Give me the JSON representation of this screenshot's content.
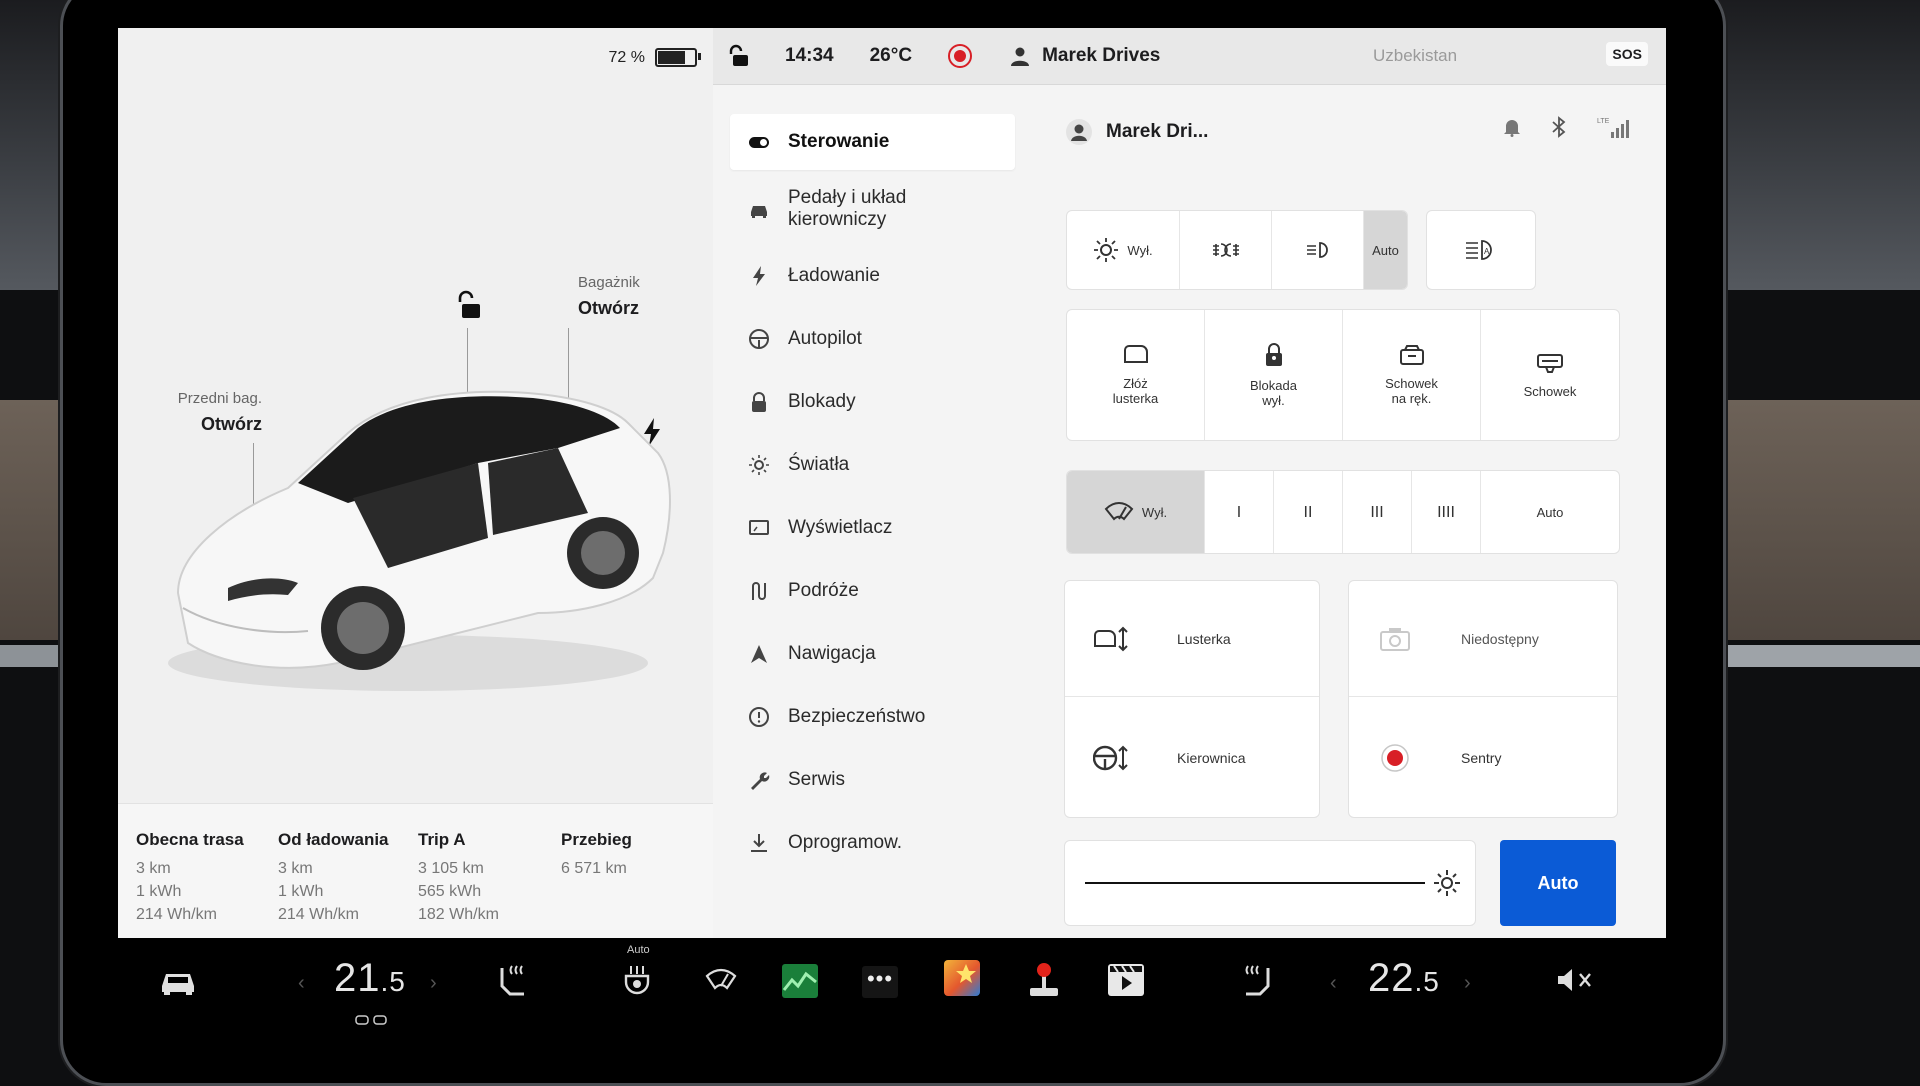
{
  "status": {
    "battery_percent": "72 %",
    "battery_level": 0.72,
    "time": "14:34",
    "temperature": "26°C",
    "user": "Marek Drives",
    "location": "Uzbekistan",
    "sos": "SOS"
  },
  "car": {
    "frunk_label": "Przedni bag.",
    "frunk_action": "Otwórz",
    "trunk_label": "Bagażnik",
    "trunk_action": "Otwórz"
  },
  "trips": [
    {
      "title": "Obecna trasa",
      "distance": "3 km",
      "energy": "1 kWh",
      "efficiency": "214 Wh/km"
    },
    {
      "title": "Od ładowania",
      "distance": "3 km",
      "energy": "1 kWh",
      "efficiency": "214 Wh/km"
    },
    {
      "title": "Trip A",
      "distance": "3 105 km",
      "energy": "565 kWh",
      "efficiency": "182 Wh/km"
    },
    {
      "title": "Przebieg",
      "distance": "6 571 km"
    }
  ],
  "menu": [
    {
      "label": "Sterowanie",
      "icon": "toggle-icon"
    },
    {
      "label": "Pedały i układ kierowniczy",
      "icon": "car-icon"
    },
    {
      "label": "Ładowanie",
      "icon": "bolt-icon"
    },
    {
      "label": "Autopilot",
      "icon": "steering-wheel-icon"
    },
    {
      "label": "Blokady",
      "icon": "lock-icon"
    },
    {
      "label": "Światła",
      "icon": "sun-icon"
    },
    {
      "label": "Wyświetlacz",
      "icon": "display-icon"
    },
    {
      "label": "Podróże",
      "icon": "route-icon"
    },
    {
      "label": "Nawigacja",
      "icon": "navigation-arrow-icon"
    },
    {
      "label": "Bezpieczeństwo",
      "icon": "alert-circle-icon"
    },
    {
      "label": "Serwis",
      "icon": "wrench-icon"
    },
    {
      "label": "Oprogramow.",
      "icon": "download-icon"
    }
  ],
  "profile": {
    "name": "Marek Dri...",
    "lte": "LTE"
  },
  "lights": {
    "off": "Wył.",
    "auto": "Auto"
  },
  "quick": [
    {
      "label": "Złóż lusterka",
      "icon": "mirror-icon"
    },
    {
      "label": "Blokada wył.",
      "icon": "child-lock-icon"
    },
    {
      "label": "Schowek na ręk.",
      "icon": "glovebox-icon"
    },
    {
      "label": "Schowek",
      "icon": "storage-icon"
    }
  ],
  "wipers": {
    "off": "Wył.",
    "speeds": [
      "I",
      "II",
      "III",
      "IIII"
    ],
    "auto": "Auto"
  },
  "adjust": {
    "mirrors": "Lusterka",
    "steering": "Kierownica",
    "unavailable": "Niedostępny",
    "sentry": "Sentry"
  },
  "brightness": {
    "auto": "Auto"
  },
  "bottom": {
    "left_temp_int": "21",
    "left_temp_dec": ".5",
    "right_temp_int": "22",
    "right_temp_dec": ".5",
    "auto_label": "Auto"
  },
  "colors": {
    "accent": "#0b5bd6",
    "sentry_red": "#d81f26"
  }
}
